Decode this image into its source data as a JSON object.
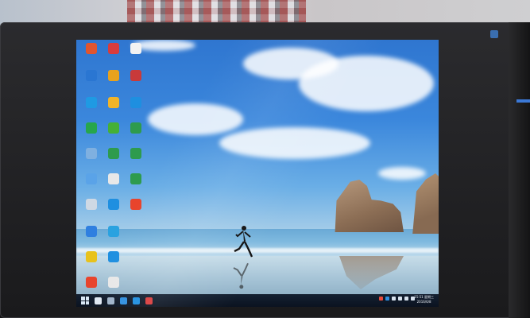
{
  "desktop": {
    "icons": [
      {
        "label": "",
        "icon": "qq-game-icon",
        "color": "#e0552f"
      },
      {
        "label": "",
        "icon": "app-icon",
        "color": "#d93c3c"
      },
      {
        "label": "",
        "icon": "document-icon",
        "color": "#f2f2f2"
      },
      {
        "label": "",
        "icon": "browser-icon",
        "color": "#2a76d2"
      },
      {
        "label": "",
        "icon": "game-icon",
        "color": "#e8a21c"
      },
      {
        "label": "",
        "icon": "game-icon",
        "color": "#c83a3a"
      },
      {
        "label": "",
        "icon": "qq-icon",
        "color": "#1f9ae3"
      },
      {
        "label": "",
        "icon": "app-icon",
        "color": "#f0b429"
      },
      {
        "label": "",
        "icon": "ie-icon",
        "color": "#1e8fe0"
      },
      {
        "label": "",
        "icon": "media-icon",
        "color": "#27a64c"
      },
      {
        "label": "",
        "icon": "wechat-icon",
        "color": "#45b035"
      },
      {
        "label": "",
        "icon": "spreadsheet-icon",
        "color": "#2e9b4d"
      },
      {
        "label": "",
        "icon": "computer-icon",
        "color": "#7fb0e0"
      },
      {
        "label": "",
        "icon": "spreadsheet-icon",
        "color": "#2e9b4d"
      },
      {
        "label": "",
        "icon": "spreadsheet-icon",
        "color": "#2e9b4d"
      },
      {
        "label": "",
        "icon": "folder-icon",
        "color": "#5aa3e8"
      },
      {
        "label": "",
        "icon": "document-icon",
        "color": "#e8e8e8"
      },
      {
        "label": "",
        "icon": "spreadsheet-icon",
        "color": "#2e9b4d"
      },
      {
        "label": "",
        "icon": "app-icon",
        "color": "#cfd9e4"
      },
      {
        "label": "",
        "icon": "bird-icon",
        "color": "#1e8fe0"
      },
      {
        "label": "",
        "icon": "shop-icon",
        "color": "#e8442c"
      },
      {
        "label": "",
        "icon": "shield-icon",
        "color": "#2f7fe0"
      },
      {
        "label": "",
        "icon": "browser-icon",
        "color": "#2aa2e0"
      },
      {
        "label": "",
        "icon": "chrome-icon",
        "color": "#e8c21c"
      },
      {
        "label": "",
        "icon": "ie-icon",
        "color": "#1e8fe0"
      },
      {
        "label": "",
        "icon": "qq-icon",
        "color": "#e8442c"
      },
      {
        "label": "",
        "icon": "pdf-icon",
        "color": "#e8e8e8"
      }
    ]
  },
  "taskbar": {
    "time": "15:51 星期三",
    "date": "2016/6/8",
    "apps": [
      {
        "icon": "search-icon",
        "color": "#dfe8f2"
      },
      {
        "icon": "task-view-icon",
        "color": "#9fb3c8"
      },
      {
        "icon": "qq-icon",
        "color": "#2f8fe0"
      },
      {
        "icon": "ie-icon",
        "color": "#1e8fe0"
      },
      {
        "icon": "app-icon",
        "color": "#d93c3c"
      }
    ]
  },
  "colors": {
    "sky": "#3b87dc",
    "taskbar": "#0b1320",
    "bezel": "#1a1a1c"
  }
}
